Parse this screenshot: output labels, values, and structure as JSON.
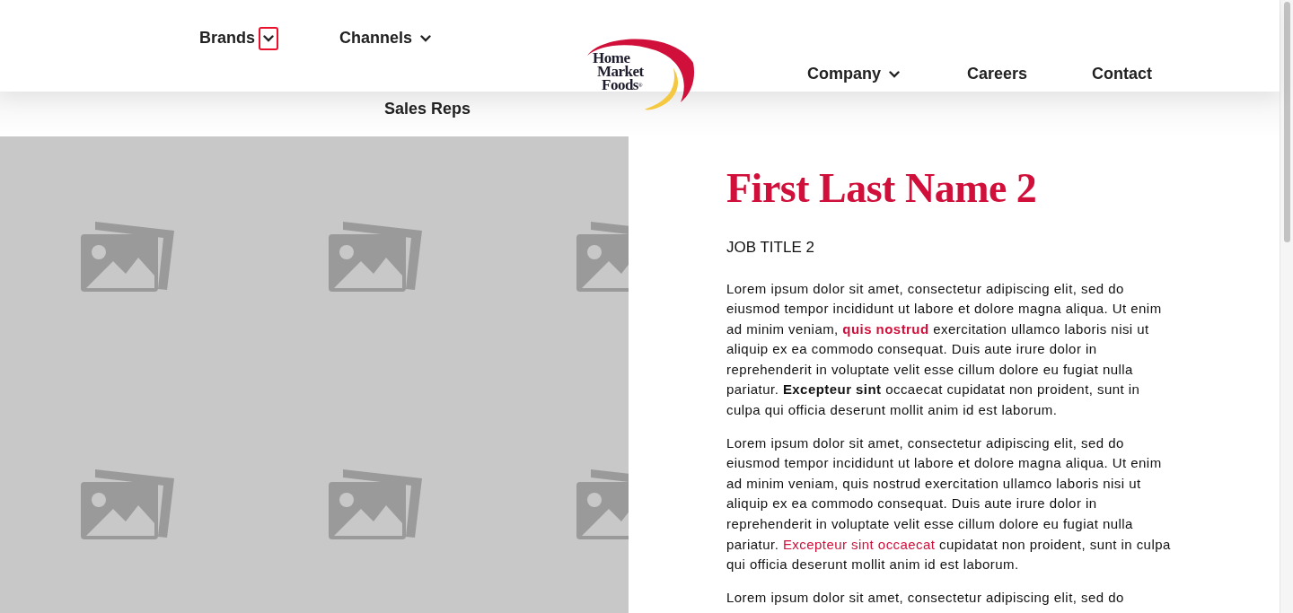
{
  "nav_left": [
    {
      "label": "Brands",
      "dropdown": true,
      "focused": true
    },
    {
      "label": "Channels",
      "dropdown": true,
      "focused": false
    }
  ],
  "submenu": {
    "label": "Sales Reps"
  },
  "logo": {
    "lines": [
      "Home",
      "Market",
      "Foods"
    ],
    "mark": "®"
  },
  "nav_right": [
    {
      "label": "Company",
      "dropdown": true,
      "focused": false
    },
    {
      "label": "Careers",
      "dropdown": false,
      "focused": false
    },
    {
      "label": "Contact",
      "dropdown": false,
      "focused": false
    }
  ],
  "profile": {
    "name": "First Last Name 2",
    "job_title": "JOB TITLE 2",
    "paragraphs": [
      [
        {
          "kind": "text",
          "text": "Lorem ipsum dolor sit amet, consectetur adipiscing elit, sed do eiusmod tempor incididunt ut labore et dolore magna aliqua. Ut enim ad minim veniam, "
        },
        {
          "kind": "boldlink",
          "text": "quis nostrud"
        },
        {
          "kind": "text",
          "text": " exercitation ullamco laboris nisi ut aliquip ex ea commodo consequat. Duis aute irure dolor in reprehenderit in voluptate velit esse cillum dolore eu fugiat nulla pariatur. "
        },
        {
          "kind": "bold",
          "text": "Excepteur sint"
        },
        {
          "kind": "text",
          "text": " occaecat cupidatat non proident, sunt in culpa qui officia deserunt mollit anim id est laborum."
        }
      ],
      [
        {
          "kind": "text",
          "text": "Lorem ipsum dolor sit amet, consectetur adipiscing elit, sed do eiusmod tempor incididunt ut labore et dolore magna aliqua. Ut enim ad minim veniam, quis nostrud exercitation ullamco laboris nisi ut aliquip ex ea commodo consequat. Duis aute irure dolor in reprehenderit in voluptate velit esse cillum dolore eu fugiat nulla pariatur. "
        },
        {
          "kind": "link",
          "text": "Excepteur sint occaecat"
        },
        {
          "kind": "text",
          "text": " cupidatat non proident, sunt in culpa qui officia deserunt mollit anim id est laborum."
        }
      ],
      [
        {
          "kind": "text",
          "text": "Lorem ipsum dolor sit amet, consectetur adipiscing elit, sed do"
        }
      ]
    ]
  }
}
